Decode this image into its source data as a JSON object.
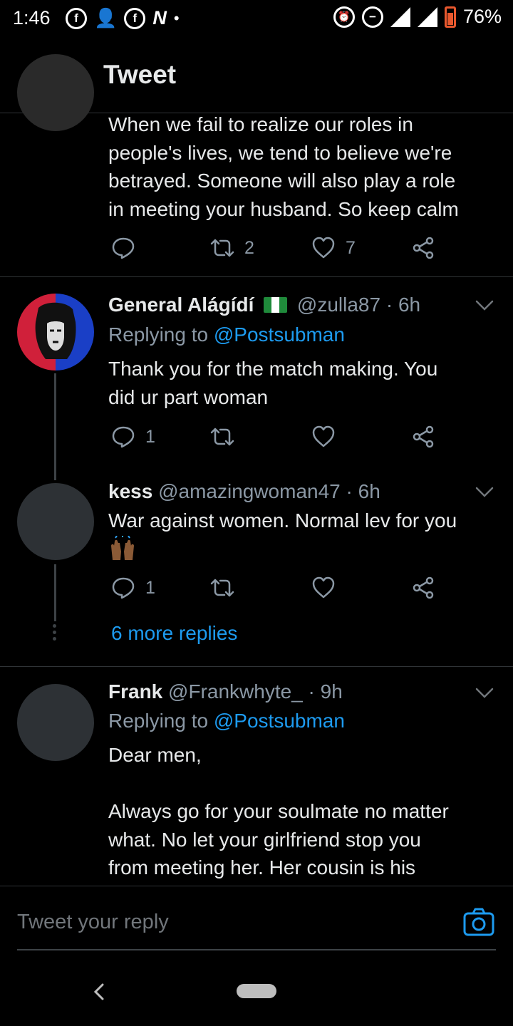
{
  "status_bar": {
    "time": "1:46",
    "battery": "76%",
    "network": "3G"
  },
  "header": {
    "title": "Tweet",
    "back_icon": "arrow-left-icon"
  },
  "top_tweet": {
    "text": "When we fail to realize our roles in\npeople's lives, we tend to believe we're\nbetrayed. Someone will also play a role\nin meeting your husband. So keep calm",
    "retweets": "2",
    "likes": "7"
  },
  "replies": [
    {
      "name": "General Alágídí",
      "flag": "nigeria-flag",
      "handle": "@zulla87 · 6h",
      "replying_prefix": "Replying to ",
      "replying_to": "@Postsubman",
      "text": "Thank you for the match making. You\ndid ur part woman",
      "reply_count": "1"
    },
    {
      "name": "kess",
      "handle": "@amazingwoman47 · 6h",
      "text": "War against women. Normal lev for you",
      "reply_count": "1"
    },
    {
      "name": "Frank",
      "handle": "@Frankwhyte_ · 9h",
      "replying_prefix": "Replying to ",
      "replying_to": "@Postsubman",
      "text": "Dear men,\n\nAlways go for your soulmate no matter\nwhat. No let your girlfriend stop you\nfrom meeting her. Her cousin is his"
    }
  ],
  "more_replies": "6 more replies",
  "reply_bar": {
    "placeholder": "Tweet your reply"
  },
  "colors": {
    "accent": "#1d9bf0",
    "background": "#000000",
    "muted": "#8b98a5"
  }
}
